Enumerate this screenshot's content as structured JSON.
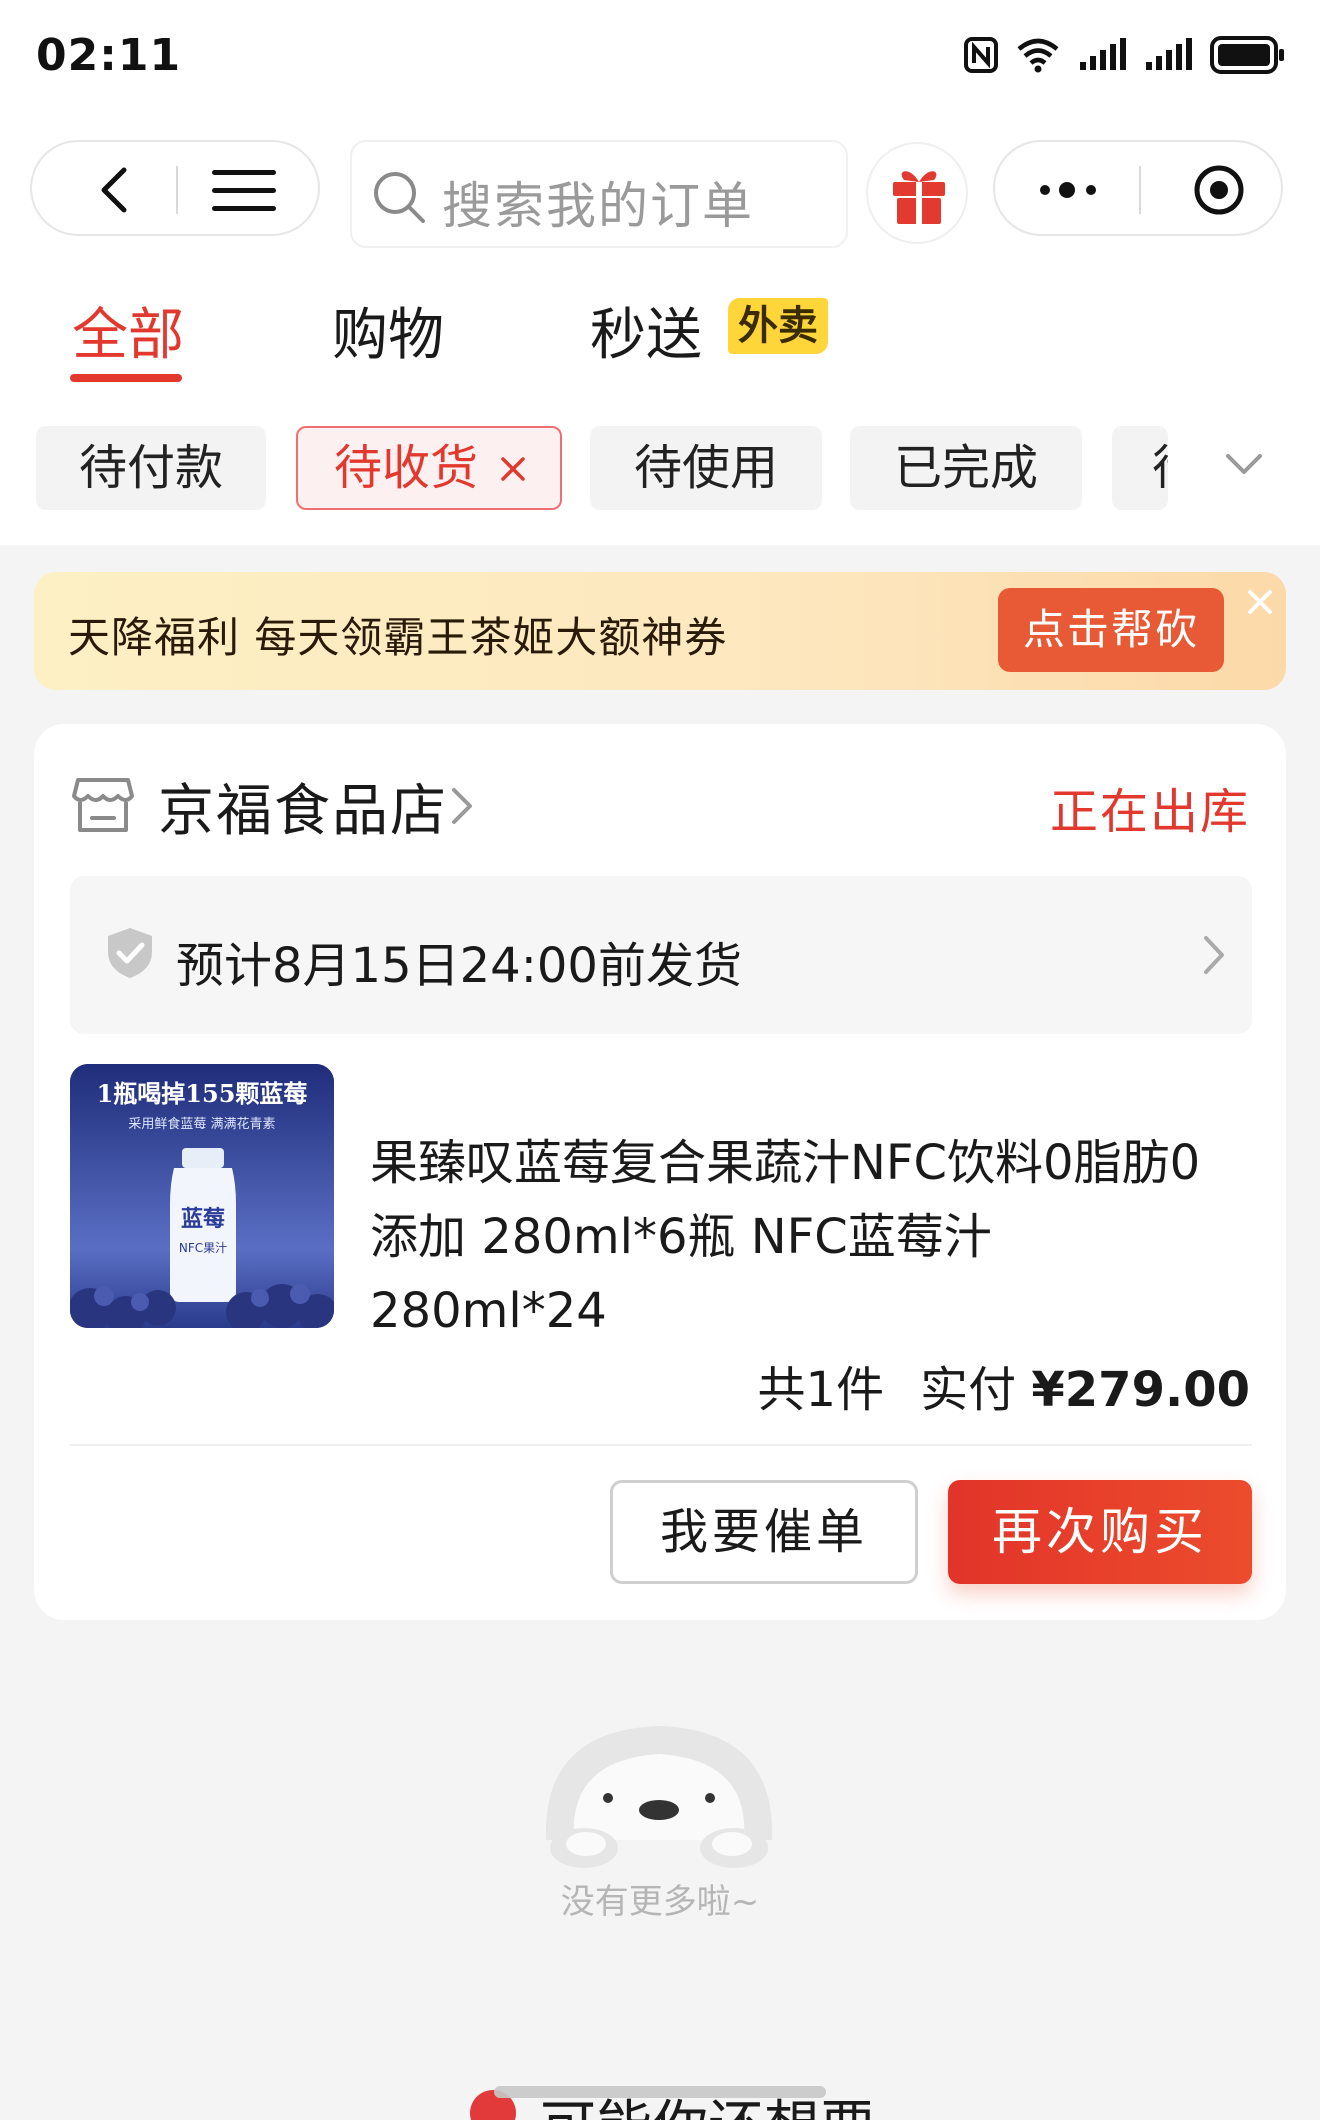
{
  "status_bar": {
    "time": "02:11"
  },
  "search": {
    "placeholder": "搜索我的订单"
  },
  "tabs": [
    {
      "label": "全部",
      "active": true
    },
    {
      "label": "购物"
    },
    {
      "label": "秒送",
      "badge": "外卖"
    }
  ],
  "filters": [
    {
      "label": "待付款"
    },
    {
      "label": "待收货",
      "selected": true
    },
    {
      "label": "待使用"
    },
    {
      "label": "已完成"
    },
    {
      "label": "待评价"
    }
  ],
  "promo": {
    "text": "天降福利 每天领霸王茶姬大额神券",
    "button": "点击帮砍"
  },
  "order": {
    "store_name": "京福食品店",
    "status": "正在出库",
    "shipping_notice": "预计8月15日24:00前发货",
    "product_image_text": "1瓶喝掉155颗蓝莓",
    "product_image_sub": "采用鲜食蓝莓 满满花青素",
    "product_image_bottle": "蓝莓",
    "product_image_nfc": "NFC果汁",
    "product_title": "果臻叹蓝莓复合果蔬汁NFC饮料0脂肪0添加 280ml*6瓶 NFC蓝莓汁 280ml*24",
    "quantity": "共1件",
    "paid_label": "实付",
    "paid_amount": "¥279.00",
    "btn_urge": "我要催单",
    "btn_rebuy": "再次购买"
  },
  "empty": {
    "text": "没有更多啦~"
  },
  "recommend": {
    "title": "可能你还想要"
  },
  "colors": {
    "accent": "#e2382e",
    "badge": "#ffd639",
    "promo_button": "#e85a35"
  }
}
